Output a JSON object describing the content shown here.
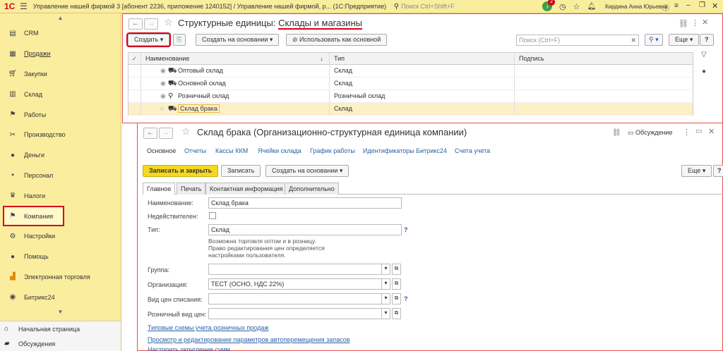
{
  "topbar": {
    "logo": "1С",
    "title": "Управление нашей фирмой 3 [абонент 2236, приложение 1240152] / Управление нашей фирмой, р...  (1С:Предприятие)",
    "search_placeholder": "Поиск Ctrl+Shift+F",
    "badge": "2",
    "user": "Кирдина Анна Юрьевна"
  },
  "sidebar": {
    "items": [
      {
        "label": "CRM",
        "icon": "crm-icon"
      },
      {
        "label": "Продажи",
        "icon": "sales-icon"
      },
      {
        "label": "Закупки",
        "icon": "purchases-icon"
      },
      {
        "label": "Склад",
        "icon": "warehouse-icon"
      },
      {
        "label": "Работы",
        "icon": "works-icon"
      },
      {
        "label": "Производство",
        "icon": "production-icon"
      },
      {
        "label": "Деньги",
        "icon": "money-icon"
      },
      {
        "label": "Персонал",
        "icon": "staff-icon"
      },
      {
        "label": "Налоги",
        "icon": "taxes-icon"
      },
      {
        "label": "Компания",
        "icon": "company-icon"
      },
      {
        "label": "Настройки",
        "icon": "settings-icon"
      },
      {
        "label": "Помощь",
        "icon": "help-icon"
      },
      {
        "label": "Электронная торговля",
        "icon": "ecommerce-icon"
      },
      {
        "label": "Битрикс24",
        "icon": "bitrix-icon"
      }
    ],
    "bottom": [
      {
        "label": "Начальная страница"
      },
      {
        "label": "Обсуждения"
      }
    ]
  },
  "list": {
    "title_prefix": "Структурные единицы: ",
    "title_main": "Склады и магазины",
    "create": "Создать",
    "create_based": "Создать на основании",
    "use_as_main": "Использовать как основной",
    "search_placeholder": "Поиск (Ctrl+F)",
    "more": "Еще",
    "help": "?",
    "columns": [
      "Наименование",
      "Тип",
      "Подпись"
    ],
    "rows": [
      {
        "name": "Оптовый склад",
        "type": "Склад",
        "sign": ""
      },
      {
        "name": "Основной склад",
        "type": "Склад",
        "sign": ""
      },
      {
        "name": "Розничный склад",
        "type": "Розничный склад",
        "sign": ""
      },
      {
        "name": "Склад брака",
        "type": "Склад",
        "sign": ""
      }
    ]
  },
  "form": {
    "title": "Склад брака (Организационно-структурная единица компании)",
    "discussion": "Обсуждение",
    "nav": [
      "Основное",
      "Отчеты",
      "Кассы ККМ",
      "Ячейки склада",
      "График работы",
      "Идентификаторы Битрикс24",
      "Счета учета"
    ],
    "save_close": "Записать и закрыть",
    "save": "Записать",
    "create_based": "Создать на основании",
    "more": "Еще",
    "help": "?",
    "tabs": [
      "Главное",
      "Печать",
      "Контактная информация",
      "Дополнительно"
    ],
    "fields": {
      "name_label": "Наименование:",
      "name_value": "Склад брака",
      "invalid_label": "Недействителен:",
      "type_label": "Тип:",
      "type_value": "Склад",
      "type_hint": "Возможна торговля оптом и в розницу.\nПраво редактирования цен определяется\nнастройками пользователя.",
      "group_label": "Группа:",
      "group_value": "",
      "org_label": "Организация:",
      "org_value": "ТЕСТ (ОСНО, НДС 22%)",
      "price_label": "Вид цен списания:",
      "price_value": "",
      "retail_label": "Розничный вид цен:",
      "retail_value": ""
    },
    "links": [
      "Типовые схемы учета розничных продаж",
      "Просмотр и редактирование параметров автоперемещения запасов",
      "Настроить округление сумм"
    ]
  },
  "colors": {
    "accent": "#d4001c",
    "panel": "#fbed9e",
    "link": "#2c5fa8",
    "button_primary": "#f6d820"
  }
}
